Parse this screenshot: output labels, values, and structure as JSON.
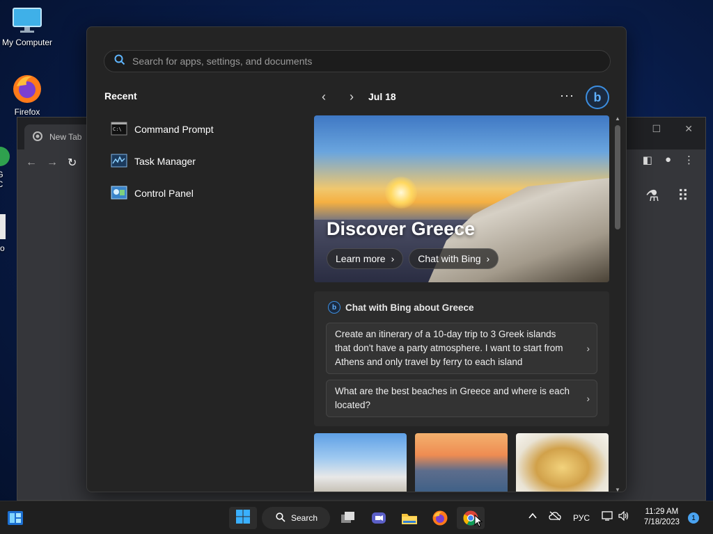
{
  "desktop": {
    "icons": [
      {
        "label": "My Computer"
      },
      {
        "label": "Firefox"
      },
      {
        "label": "G\nC"
      },
      {
        "label": "No"
      }
    ]
  },
  "chrome": {
    "tab_title": "New Tab"
  },
  "start_menu": {
    "search_placeholder": "Search for apps, settings, and documents",
    "recent_title": "Recent",
    "recent_items": [
      {
        "label": "Command Prompt",
        "icon": "command-prompt-icon"
      },
      {
        "label": "Task Manager",
        "icon": "task-manager-icon"
      },
      {
        "label": "Control Panel",
        "icon": "control-panel-icon"
      }
    ],
    "feed": {
      "date": "Jul 18",
      "more": "···",
      "hero": {
        "title": "Discover Greece",
        "buttons": [
          "Learn more",
          "Chat with Bing"
        ]
      },
      "chat": {
        "heading": "Chat with Bing about Greece",
        "prompts": [
          "Create an itinerary of a 10-day trip to 3 Greek islands that don't have a party atmosphere. I want to start from Athens and only travel by ferry to each island",
          "What are the best beaches in Greece and where is each located?"
        ]
      }
    }
  },
  "taskbar": {
    "search_label": "Search",
    "language": "РУС",
    "time": "11:29 AM",
    "date": "7/18/2023",
    "notifications": "1"
  },
  "colors": {
    "accent": "#4aa3f0",
    "start_bg": "#242424",
    "taskbar_bg": "#1f1f1f"
  }
}
